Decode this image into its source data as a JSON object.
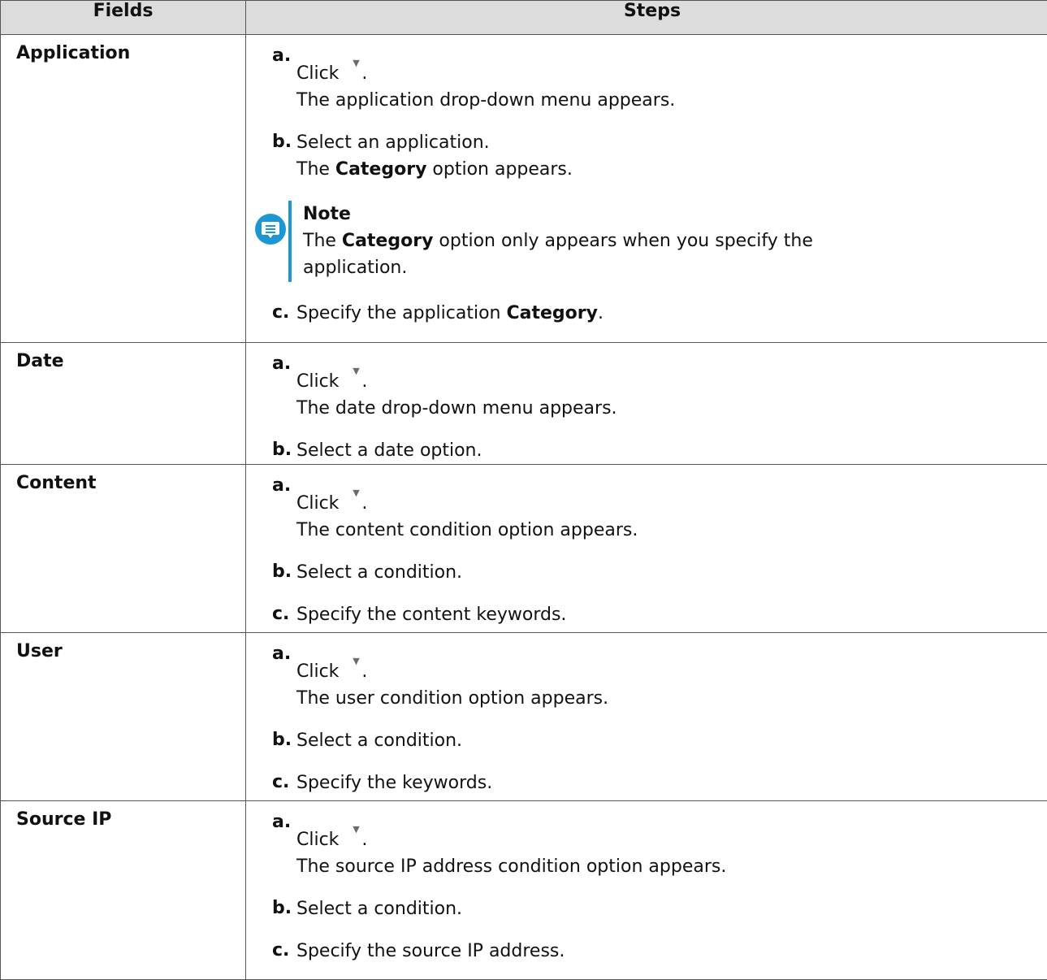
{
  "header": {
    "fields": "Fields",
    "steps": "Steps"
  },
  "rows": [
    {
      "field": "Application",
      "a": {
        "letter": "a.",
        "click": "Click",
        "dot": ".",
        "result": "The application drop-down menu appears."
      },
      "b": {
        "letter": "b.",
        "text": "Select an application.",
        "result_pre": "The ",
        "result_bold": "Category",
        "result_post": " option appears."
      },
      "note": {
        "title": "Note",
        "pre": "The ",
        "bold": "Category",
        "post_line1": " option only appears when you specify the",
        "line2": "application."
      },
      "c": {
        "letter": "c.",
        "pre": "Specify the application ",
        "bold": "Category",
        "post": "."
      }
    },
    {
      "field": "Date",
      "a": {
        "letter": "a.",
        "click": "Click",
        "dot": ".",
        "result": "The date drop-down menu appears."
      },
      "b": {
        "letter": "b.",
        "text": "Select a date option."
      }
    },
    {
      "field": "Content",
      "a": {
        "letter": "a.",
        "click": "Click",
        "dot": ".",
        "result": "The content condition option appears."
      },
      "b": {
        "letter": "b.",
        "text": "Select a condition."
      },
      "c": {
        "letter": "c.",
        "text": "Specify the content keywords."
      }
    },
    {
      "field": "User",
      "a": {
        "letter": "a.",
        "click": "Click",
        "dot": ".",
        "result": "The user condition option appears."
      },
      "b": {
        "letter": "b.",
        "text": "Select a condition."
      },
      "c": {
        "letter": "c.",
        "text": "Specify the keywords."
      }
    },
    {
      "field": "Source IP",
      "a": {
        "letter": "a.",
        "click": "Click",
        "dot": ".",
        "result": "The source IP address condition option appears."
      },
      "b": {
        "letter": "b.",
        "text": "Select a condition."
      },
      "c": {
        "letter": "c.",
        "text": "Specify the source IP address."
      }
    }
  ],
  "icons": {
    "caret": "caret-down-icon",
    "note": "note-speech-bubble-icon"
  },
  "colors": {
    "header_bg": "#dcdcdc",
    "note_accent": "#1d97d4",
    "border": "#555555"
  }
}
